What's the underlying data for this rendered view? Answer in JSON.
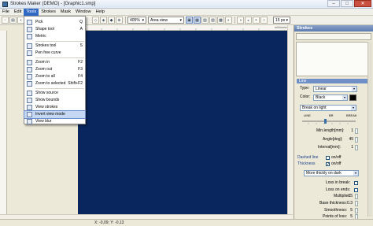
{
  "window": {
    "title": "Strokes Maker (DEMO) - [Graphic1.smp]",
    "minimize": "–",
    "maximize": "□",
    "close": "✕"
  },
  "menubar": [
    "File",
    "Edit",
    "Tools",
    "Strokes",
    "Mask",
    "Window",
    "Help"
  ],
  "toolbar": {
    "zoom": "405%",
    "view_mode": "Area view",
    "size": "15 px"
  },
  "ruler": {
    "unit": "millimeters"
  },
  "tools_menu": [
    {
      "label": "Pick",
      "shortcut": "Q"
    },
    {
      "label": "Shape tool",
      "shortcut": "A"
    },
    {
      "label": "Metric",
      "shortcut": ""
    },
    {
      "label": "Strokes tool",
      "shortcut": "S"
    },
    {
      "label": "Pen free curve",
      "shortcut": ""
    },
    {
      "label": "Zoom in",
      "shortcut": "F2"
    },
    {
      "label": "Zoom out",
      "shortcut": "F3"
    },
    {
      "label": "Zoom to all",
      "shortcut": "F4"
    },
    {
      "label": "Zoom to selected",
      "shortcut": "Shift+F2"
    },
    {
      "label": "Show source",
      "shortcut": ""
    },
    {
      "label": "Show bounds",
      "shortcut": ""
    },
    {
      "label": "View strokes",
      "shortcut": ""
    },
    {
      "label": "Invert view mode",
      "shortcut": ""
    },
    {
      "label": "View blur",
      "shortcut": ""
    }
  ],
  "panel": {
    "title": "Strokes",
    "line_group": "Line",
    "type_label": "Type:",
    "type_value": "Linear",
    "color_label": "Color:",
    "color_value": "Black",
    "break_value": "Break on light",
    "slider_labels": [
      "LINE",
      "BR",
      "BREAK"
    ],
    "min_length_label": "Min.length[mm]:",
    "min_length": "1",
    "angle_label": "Angle[deg]:",
    "angle": "45",
    "interval_label": "Interval[mm]:",
    "interval": "1",
    "dashed_label": "Dashed line",
    "dashed_toggle": "on/off",
    "thickness_label": "Thickness",
    "thickness_toggle": "on/off",
    "thickness_mode": "More thickly on dark",
    "loss_break_label": "Loss in break:",
    "loss_ends_label": "Loss on ends:",
    "multiplier_label": "Multiplier:",
    "multiplier": "15",
    "base_thickness_label": "Base thickness:",
    "base_thickness": "0.3",
    "smoothness_label": "Smoothness:",
    "smoothness": "5",
    "points_loss_label": "Points of loss:",
    "points_loss": "5"
  },
  "status": {
    "coords": "X: -0,09; Y: -0,13"
  },
  "colors": {
    "canvas": "#09275e",
    "highlight": "#316ac5"
  }
}
